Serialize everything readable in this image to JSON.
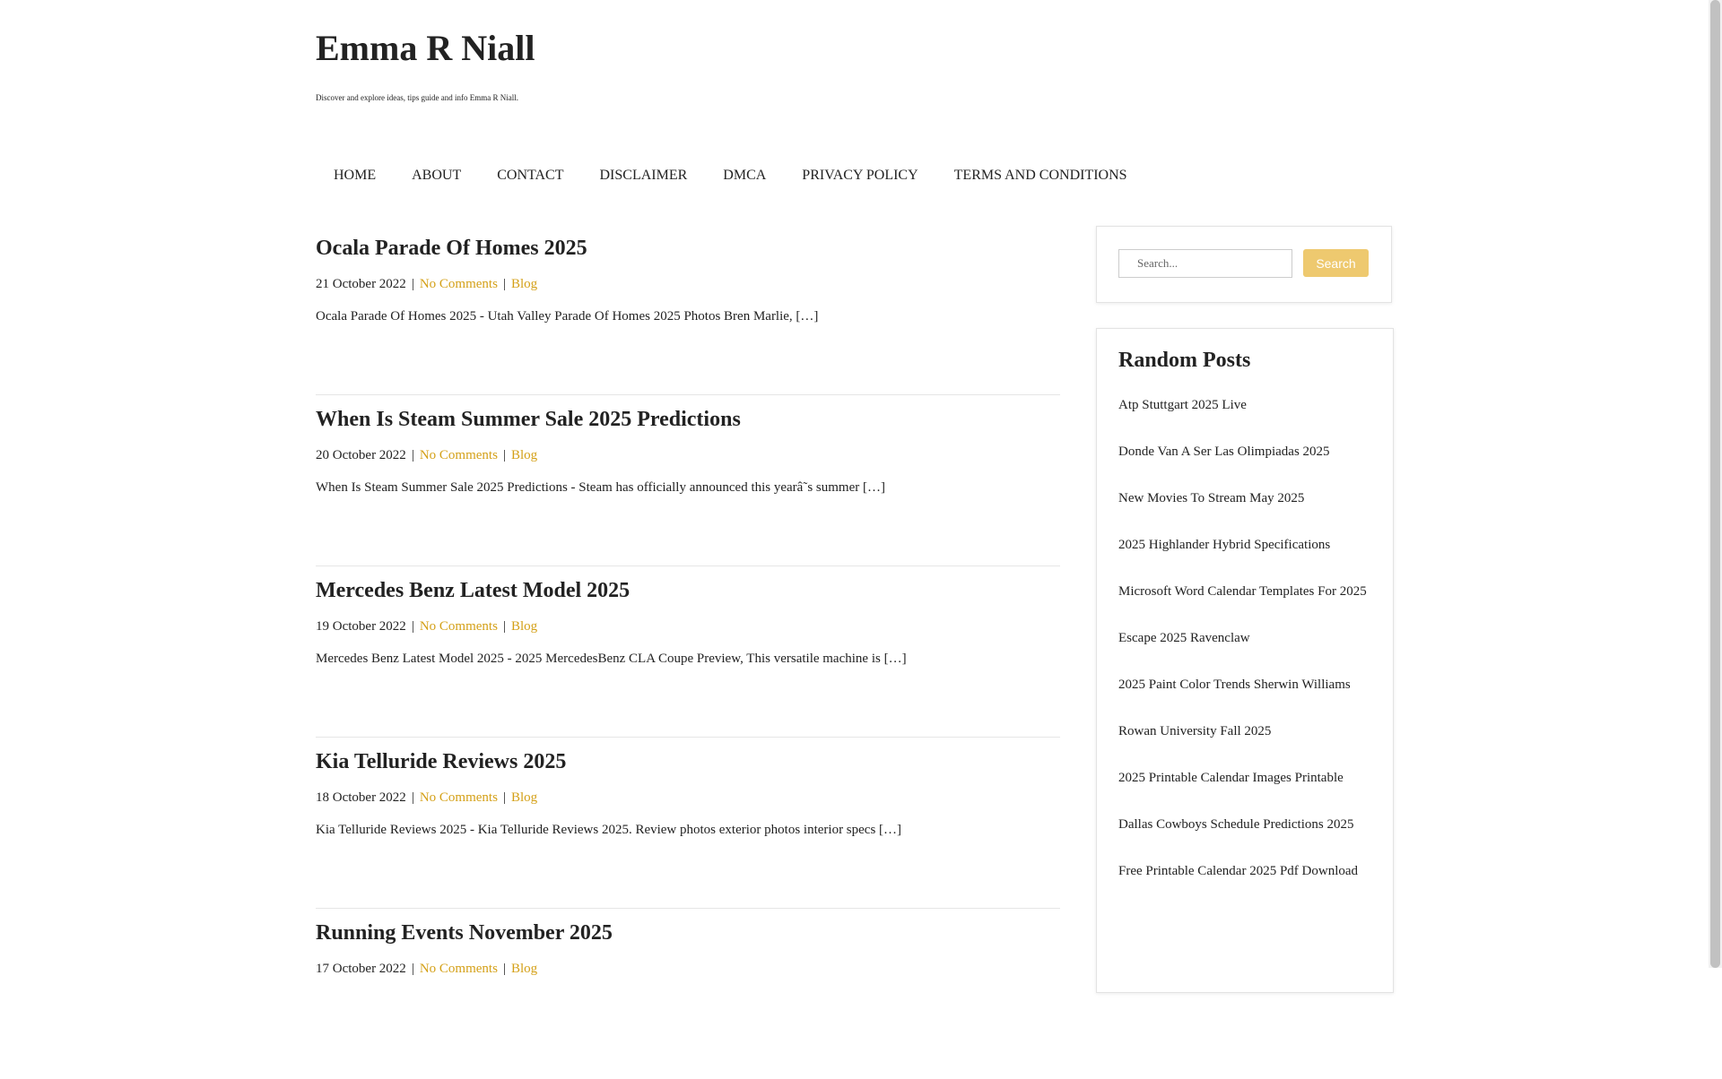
{
  "site": {
    "title": "Emma R Niall",
    "description": "Discover and explore ideas, tips guide and info Emma R Niall."
  },
  "nav": {
    "items": [
      {
        "label": "HOME"
      },
      {
        "label": "ABOUT"
      },
      {
        "label": "CONTACT"
      },
      {
        "label": "DISCLAIMER"
      },
      {
        "label": "DMCA"
      },
      {
        "label": "PRIVACY POLICY"
      },
      {
        "label": "TERMS AND CONDITIONS"
      }
    ]
  },
  "posts": [
    {
      "title": "Ocala Parade Of Homes 2025",
      "date": "21 October 2022",
      "comments": "No Comments",
      "category": "Blog",
      "excerpt": "Ocala Parade Of Homes 2025 - Utah Valley Parade Of Homes 2025 Photos Bren Marlie, […]"
    },
    {
      "title": "When Is Steam Summer Sale 2025 Predictions",
      "date": "20 October 2022",
      "comments": "No Comments",
      "category": "Blog",
      "excerpt": "When Is Steam Summer Sale 2025 Predictions - Steam has officially announced this yearâ˜s summer […]"
    },
    {
      "title": "Mercedes Benz Latest Model 2025",
      "date": "19 October 2022",
      "comments": "No Comments",
      "category": "Blog",
      "excerpt": "Mercedes Benz Latest Model 2025 - 2025 MercedesBenz CLA Coupe Preview, This versatile machine is […]"
    },
    {
      "title": "Kia Telluride Reviews 2025",
      "date": "18 October 2022",
      "comments": "No Comments",
      "category": "Blog",
      "excerpt": "Kia Telluride Reviews 2025 - Kia Telluride Reviews 2025. Review photos exterior photos interior specs […]"
    },
    {
      "title": "Running Events November 2025",
      "date": "17 October 2022",
      "comments": "No Comments",
      "category": "Blog",
      "excerpt": ""
    }
  ],
  "meta_separator": "|",
  "search": {
    "placeholder": "Search...",
    "button_label": "Search"
  },
  "random_posts": {
    "title": "Random Posts",
    "items": [
      "Atp Stuttgart 2025 Live",
      "Donde Van A Ser Las Olimpiadas 2025",
      "New Movies To Stream May 2025",
      "2025 Highlander Hybrid Specifications",
      "Microsoft Word Calendar Templates For 2025",
      "Escape 2025 Ravenclaw",
      "2025 Paint Color Trends Sherwin Williams",
      "Rowan University Fall 2025",
      "2025 Printable Calendar Images Printable",
      "Dallas Cowboys Schedule Predictions 2025",
      "Free Printable Calendar 2025 Pdf Download"
    ]
  },
  "colors": {
    "accent_link": "#d4a017",
    "search_button": "#eec96f",
    "text": "#222222"
  }
}
